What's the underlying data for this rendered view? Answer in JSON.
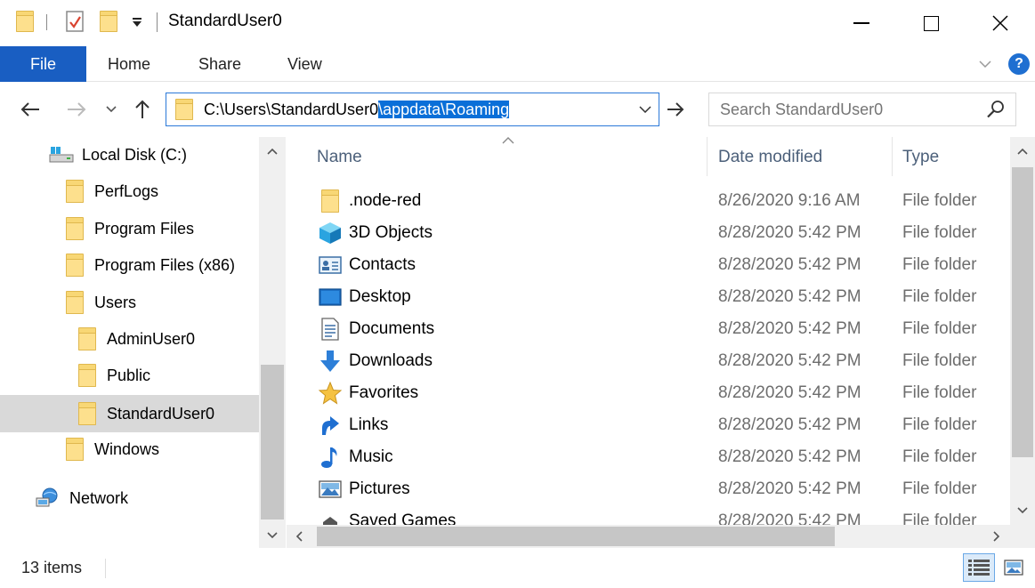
{
  "window": {
    "title": "StandardUser0",
    "minimize_glyph": "—",
    "maximize_glyph": "☐",
    "close_glyph": "✕"
  },
  "ribbon": {
    "file_label": "File",
    "tabs": [
      {
        "label": "Home"
      },
      {
        "label": "Share"
      },
      {
        "label": "View"
      }
    ],
    "help_label": "?"
  },
  "address": {
    "path_plain": "C:\\Users\\StandardUser0",
    "path_selected": "\\appdata\\Roaming"
  },
  "search": {
    "placeholder": "Search StandardUser0"
  },
  "nav_tree": [
    {
      "label": "Local Disk (C:)",
      "icon": "drive-icon"
    },
    {
      "label": "PerfLogs",
      "icon": "folder-icon"
    },
    {
      "label": "Program Files",
      "icon": "folder-icon"
    },
    {
      "label": "Program Files (x86)",
      "icon": "folder-icon"
    },
    {
      "label": "Users",
      "icon": "folder-icon"
    },
    {
      "label": "AdminUser0",
      "icon": "folder-icon"
    },
    {
      "label": "Public",
      "icon": "folder-icon"
    },
    {
      "label": "StandardUser0",
      "icon": "folder-icon",
      "selected": true
    },
    {
      "label": "Windows",
      "icon": "folder-icon"
    },
    {
      "label": "Network",
      "icon": "network-icon"
    }
  ],
  "columns": {
    "name": "Name",
    "date": "Date modified",
    "type": "Type"
  },
  "files": [
    {
      "name": ".node-red",
      "date": "8/26/2020 9:16 AM",
      "type": "File folder",
      "icon": "folder-icon"
    },
    {
      "name": "3D Objects",
      "date": "8/28/2020 5:42 PM",
      "type": "File folder",
      "icon": "3d-objects-icon"
    },
    {
      "name": "Contacts",
      "date": "8/28/2020 5:42 PM",
      "type": "File folder",
      "icon": "contacts-icon"
    },
    {
      "name": "Desktop",
      "date": "8/28/2020 5:42 PM",
      "type": "File folder",
      "icon": "desktop-icon"
    },
    {
      "name": "Documents",
      "date": "8/28/2020 5:42 PM",
      "type": "File folder",
      "icon": "documents-icon"
    },
    {
      "name": "Downloads",
      "date": "8/28/2020 5:42 PM",
      "type": "File folder",
      "icon": "downloads-icon"
    },
    {
      "name": "Favorites",
      "date": "8/28/2020 5:42 PM",
      "type": "File folder",
      "icon": "favorites-icon"
    },
    {
      "name": "Links",
      "date": "8/28/2020 5:42 PM",
      "type": "File folder",
      "icon": "links-icon"
    },
    {
      "name": "Music",
      "date": "8/28/2020 5:42 PM",
      "type": "File folder",
      "icon": "music-icon"
    },
    {
      "name": "Pictures",
      "date": "8/28/2020 5:42 PM",
      "type": "File folder",
      "icon": "pictures-icon"
    },
    {
      "name": "Saved Games",
      "date": "8/28/2020 5:42 PM",
      "type": "File folder",
      "icon": "saved-games-icon"
    }
  ],
  "status": {
    "item_count": "13 items"
  },
  "colors": {
    "file_tab": "#195ec2",
    "selection": "#0a6fd8",
    "folder": "#f8d775"
  }
}
